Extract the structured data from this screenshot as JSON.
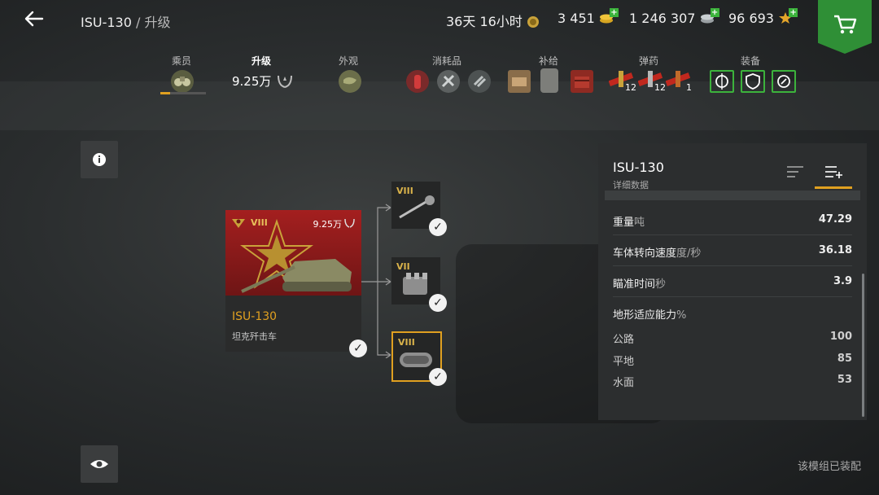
{
  "header": {
    "title": "ISU-130",
    "separator": " / ",
    "section": "升级",
    "premium_time": "36天 16小时",
    "gold": "3 451",
    "credits": "1 246 307",
    "free_xp": "96 693"
  },
  "tabs": [
    {
      "label": "乘员",
      "icon": "binoculars-icon"
    },
    {
      "label": "升级",
      "value": "9.25万",
      "icon": "xp-wreath-icon"
    },
    {
      "label": "外观",
      "icon": "camouflage-icon"
    },
    {
      "label": "消耗品",
      "icon": "consumables-icon"
    },
    {
      "label": "补给",
      "icon": "provisions-icon"
    },
    {
      "label": "弹药",
      "icon": "ammo-icon",
      "counts": [
        "12",
        "12",
        "1"
      ]
    },
    {
      "label": "装备",
      "icon": "equipment-icon"
    }
  ],
  "tank": {
    "tier": "VIII",
    "xp": "9.25万",
    "name": "ISU-130",
    "class": "坦克歼击车"
  },
  "modules": [
    {
      "tier": "VIII",
      "type": "gun"
    },
    {
      "tier": "VII",
      "type": "engine"
    },
    {
      "tier": "VIII",
      "type": "tracks",
      "selected": true
    }
  ],
  "panel": {
    "title": "ISU-130",
    "subtitle": "详细数据",
    "rows": [
      {
        "label": "重量",
        "unit": "吨",
        "value": "47.29"
      },
      {
        "label": "车体转向速度",
        "unit": "度/秒",
        "value": "36.18"
      },
      {
        "label": "瞄准时间",
        "unit": "秒",
        "value": "3.9"
      }
    ],
    "terrain_label": "地形适应能力",
    "terrain_unit": "%",
    "terrain": [
      {
        "label": "公路",
        "value": "100"
      },
      {
        "label": "平地",
        "value": "85"
      },
      {
        "label": "水面",
        "value": "53"
      }
    ]
  },
  "footer": {
    "status": "该模组已装配"
  },
  "colors": {
    "accent": "#e0a020",
    "tank_bg": "#a41f1f",
    "shop": "#2f8f36",
    "plus": "#3cb33c"
  }
}
